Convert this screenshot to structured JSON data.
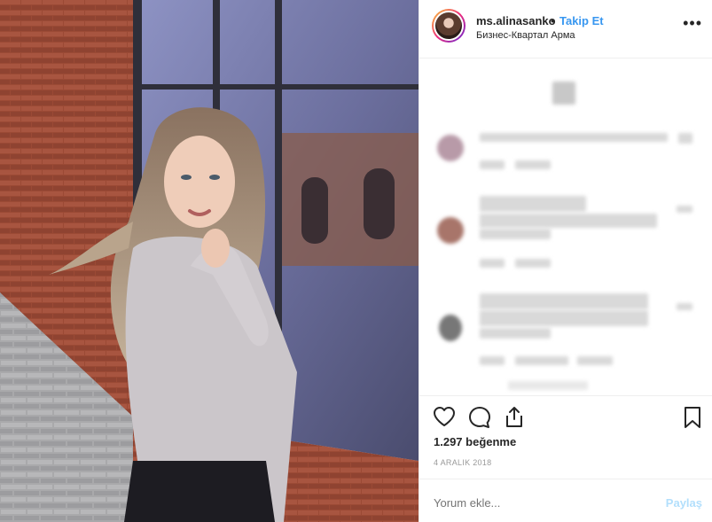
{
  "post": {
    "username": "ms.alinasanko",
    "separator": "•",
    "follow_label": "Takip Et",
    "location": "Бизнес-Квартал Арма",
    "more_icon": "more-horizontal-icon",
    "likes_text": "1.297 beğenme",
    "date_text": "4 ARALIK 2018",
    "comment_placeholder": "Yorum ekle...",
    "post_label": "Paylaş"
  },
  "icons": {
    "like": "heart-icon",
    "comment": "comment-bubble-icon",
    "share": "share-icon",
    "save": "bookmark-icon"
  },
  "colors": {
    "accent": "#3897f0",
    "post_disabled": "#b2dffc",
    "text": "#262626",
    "muted": "#999999"
  }
}
